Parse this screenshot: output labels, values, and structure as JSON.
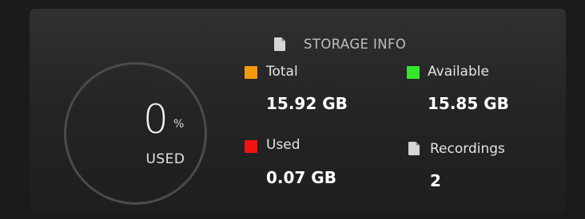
{
  "usage": {
    "percent_value": "0",
    "percent_sign": "%",
    "caption": "USED",
    "ring_fraction": 0.0
  },
  "header": {
    "title": "STORAGE INFO",
    "icon": "document-icon"
  },
  "stats": {
    "total": {
      "label": "Total",
      "value": "15.92 GB",
      "color": "#f59a0b"
    },
    "available": {
      "label": "Available",
      "value": "15.85 GB",
      "color": "#34e82c"
    },
    "used": {
      "label": "Used",
      "value": "0.07 GB",
      "color": "#f21414"
    },
    "recordings": {
      "label": "Recordings",
      "value": "2",
      "icon": "document-icon"
    }
  },
  "colors": {
    "card_bg_top": "#303030",
    "card_bg_bottom": "#1e1e1e",
    "ring": "#4b4b4b",
    "text": "#e4e4e4"
  }
}
